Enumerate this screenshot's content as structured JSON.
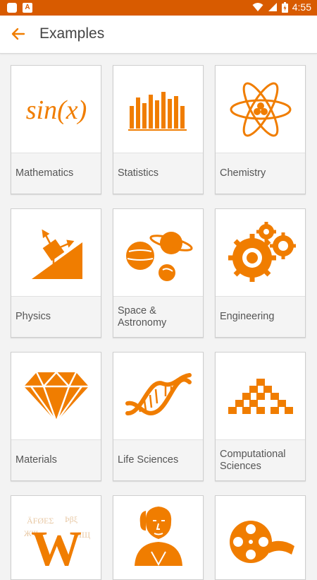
{
  "status_bar": {
    "time": "4:55",
    "colors": {
      "bar": "#d85b00"
    },
    "icons": [
      "notification-icon",
      "app-icon",
      "wifi-icon",
      "signal-icon",
      "battery-icon"
    ]
  },
  "appbar": {
    "title": "Examples",
    "back_icon": "arrow-back-icon"
  },
  "theme": {
    "accent": "#f07d00"
  },
  "tiles": [
    {
      "label": "Mathematics",
      "icon": "sin-x-icon"
    },
    {
      "label": "Statistics",
      "icon": "bar-chart-icon"
    },
    {
      "label": "Chemistry",
      "icon": "atom-icon"
    },
    {
      "label": "Physics",
      "icon": "inclined-plane-icon"
    },
    {
      "label": "Space & Astronomy",
      "icon": "planets-icon"
    },
    {
      "label": "Engineering",
      "icon": "gears-icon"
    },
    {
      "label": "Materials",
      "icon": "diamond-icon"
    },
    {
      "label": "Life Sciences",
      "icon": "dna-icon"
    },
    {
      "label": "Computational Sciences",
      "icon": "cellular-automaton-icon"
    },
    {
      "label": "",
      "icon": "letter-w-icon"
    },
    {
      "label": "",
      "icon": "historical-person-icon"
    },
    {
      "label": "",
      "icon": "film-reel-icon"
    }
  ]
}
